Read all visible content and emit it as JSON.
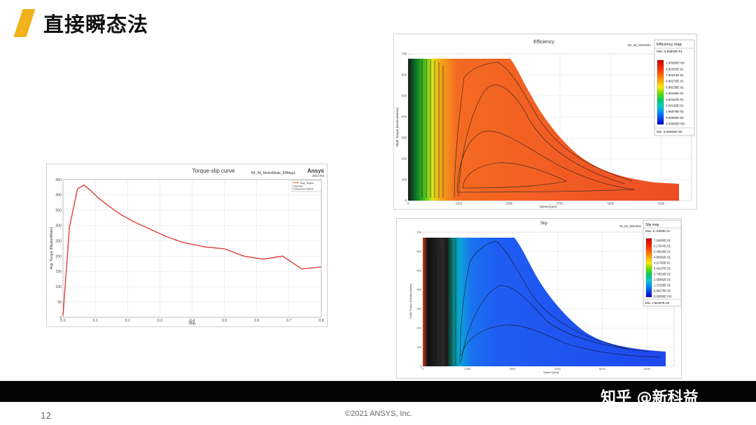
{
  "slide": {
    "title": "直接瞬态法",
    "page_number": "12",
    "copyright": "©2021 ANSYS, Inc.",
    "watermark": "知乎 @新科益",
    "accent_color": "#f2b21b"
  },
  "chart_data": [
    {
      "type": "line",
      "title": "Torque-slip curve",
      "subtitle": "IM_IM_MotorMode_EffMap1",
      "brand": "Ansys",
      "brand_version": "2024 R2",
      "xlabel": "Slip",
      "ylabel": "Avg. Torque [NewtonMeter]",
      "xlim": [
        0,
        0.8
      ],
      "ylim": [
        0,
        450
      ],
      "xticks": [
        "0.0",
        "0.1",
        "0.2",
        "0.3",
        "0.4",
        "0.5",
        "0.6",
        "0.7",
        "0.8"
      ],
      "yticks": [
        "0",
        "50",
        "100",
        "150",
        "200",
        "250",
        "300",
        "350",
        "400",
        "450"
      ],
      "grid": true,
      "legend_position": "top-right",
      "series": [
        {
          "name": "Avg_Torque",
          "legend_sub1": "Imported",
          "legend_sub2": "Frequency='180Hz'",
          "color": "#e0403a",
          "x": [
            0.0,
            0.02,
            0.045,
            0.065,
            0.085,
            0.11,
            0.14,
            0.18,
            0.22,
            0.27,
            0.32,
            0.37,
            0.44,
            0.5,
            0.56,
            0.62,
            0.68,
            0.74,
            0.8
          ],
          "y": [
            5,
            295,
            420,
            432,
            415,
            390,
            365,
            335,
            312,
            288,
            264,
            245,
            230,
            224,
            200,
            190,
            200,
            158,
            165
          ]
        }
      ]
    },
    {
      "type": "heatmap",
      "title": "Efficiency",
      "subtitle": "IM_IM_MotorMo",
      "xlabel": "Speed [rpm]",
      "ylabel": "Shaft Torque [NewtonMeter]",
      "xlim": [
        0,
        7000
      ],
      "ylim": [
        0,
        700
      ],
      "xticks": [
        "0",
        "1250",
        "2500",
        "3750",
        "5000",
        "6250",
        "7500"
      ],
      "yticks": [
        "0",
        "100",
        "200",
        "300",
        "400",
        "500",
        "600",
        "700"
      ],
      "legend": {
        "title": "Efficiency map",
        "max": "Max: 9.55802E-01",
        "min": "Min: 0.00000E+00",
        "levels": [
          "1.00000E+00",
          "8.82353E-01",
          "7.84314E-01",
          "6.86275E-01",
          "5.88235E-01",
          "4.90196E-01",
          "3.92157E-01",
          "2.94118E-01",
          "1.96078E-01",
          "9.80392E-02",
          "0.00000E+00"
        ]
      }
    },
    {
      "type": "heatmap",
      "title": "Slip",
      "subtitle": "IM_IM_MotorMo",
      "xlabel": "Speed [rpm]",
      "ylabel": "Shaft Torque [NewtonMeter]",
      "xlim": [
        0,
        7000
      ],
      "ylim": [
        0,
        700
      ],
      "xticks": [
        "0",
        "1250",
        "2500",
        "3750",
        "5000",
        "6250",
        "7500"
      ],
      "yticks": [
        "0",
        "100",
        "200",
        "300",
        "400",
        "500",
        "600",
        "700"
      ],
      "legend": {
        "title": "Slip map",
        "max": "Max: 6.71950E-01",
        "min": "Min: 2.95497E-03",
        "levels": [
          "7.00000E-01",
          "6.17647E-01",
          "5.49020E-01",
          "4.80392E-01",
          "4.11765E-01",
          "3.43137E-01",
          "2.74510E-01",
          "2.05882E-01",
          "1.37255E-01",
          "6.86275E-02",
          "0.00000E+00"
        ]
      }
    }
  ]
}
